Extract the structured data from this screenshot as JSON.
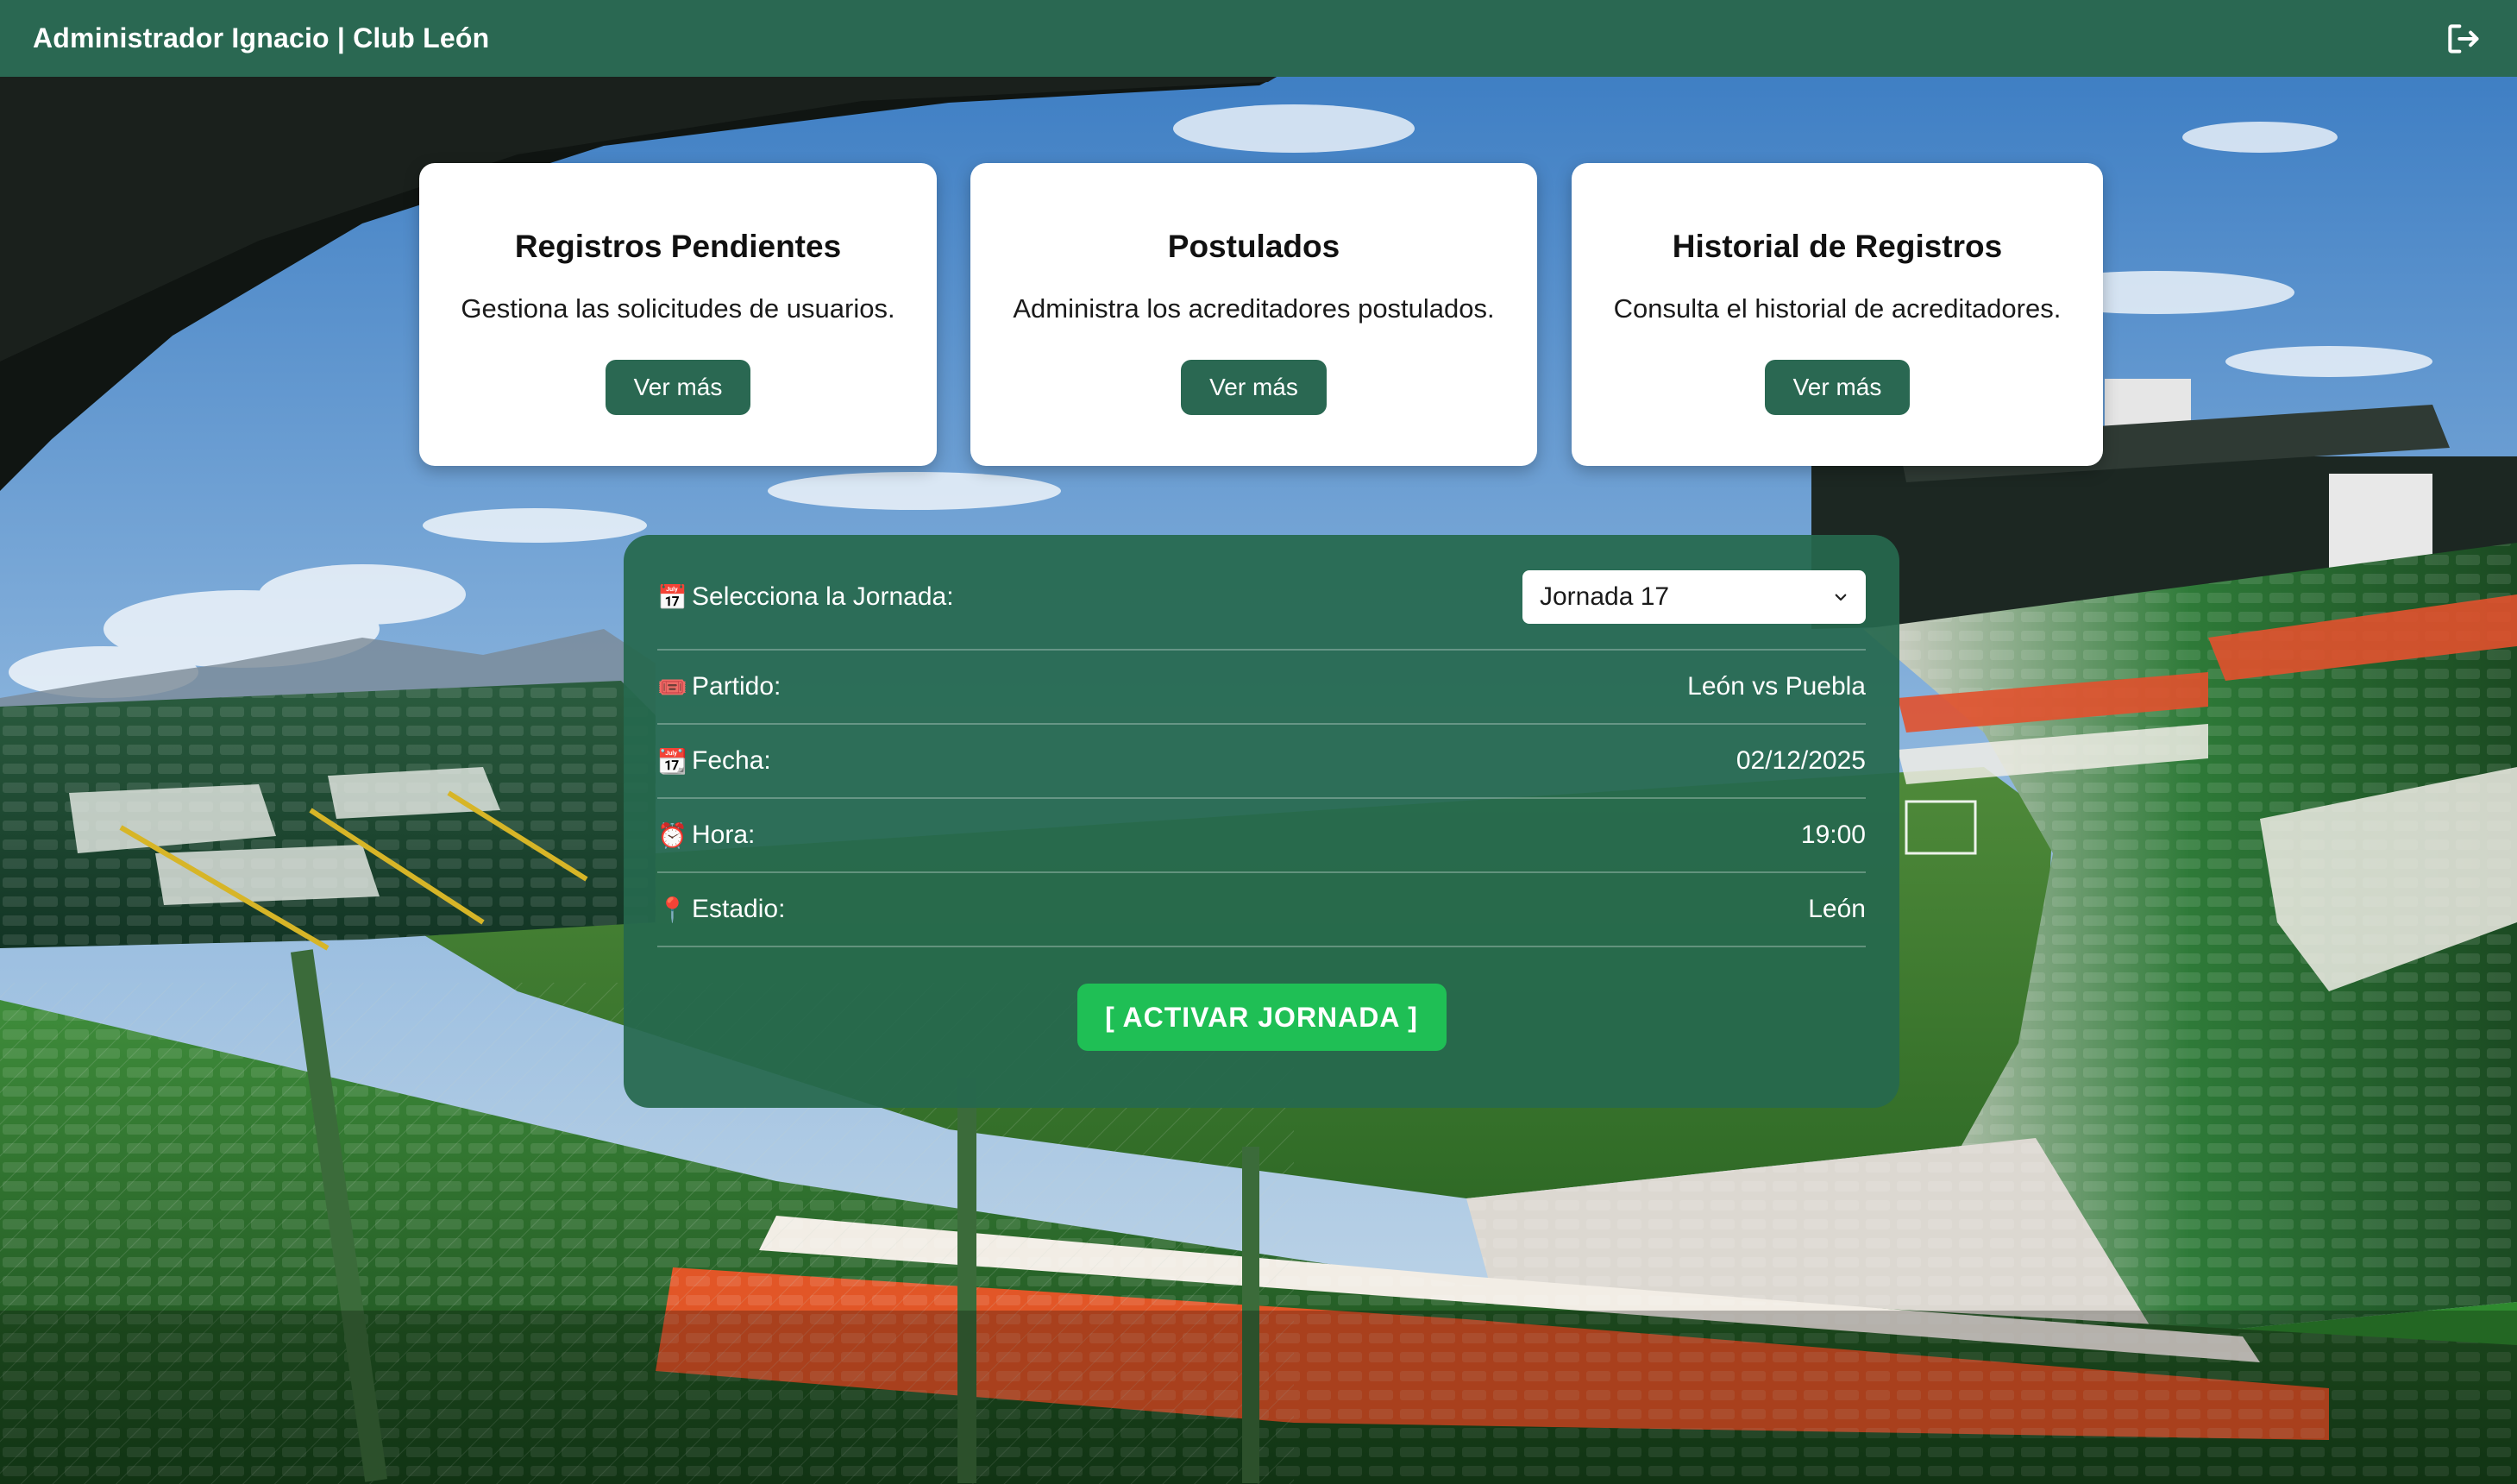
{
  "header": {
    "title": "Administrador Ignacio | Club León",
    "logout_icon": "logout-icon"
  },
  "cards": [
    {
      "title": "Registros Pendientes",
      "description": "Gestiona las solicitudes de usuarios.",
      "button": "Ver más"
    },
    {
      "title": "Postulados",
      "description": "Administra los acreditadores postulados.",
      "button": "Ver más"
    },
    {
      "title": "Historial de Registros",
      "description": "Consulta el historial de acreditadores.",
      "button": "Ver más"
    }
  ],
  "jornada": {
    "select_label": "Selecciona la Jornada:",
    "select_icon": "📅",
    "selected": "Jornada 17",
    "rows": [
      {
        "icon": "🎟️",
        "label": "Partido:",
        "value": "León vs Puebla"
      },
      {
        "icon": "📆",
        "label": "Fecha:",
        "value": "02/12/2025"
      },
      {
        "icon": "⏰",
        "label": "Hora:",
        "value": "19:00"
      },
      {
        "icon": "📍",
        "label": "Estadio:",
        "value": "León"
      }
    ],
    "activate_button": "[ ACTIVAR JORNADA ]"
  },
  "colors": {
    "header": "#2a6852",
    "panel": "#26684e",
    "button": "#2a6852",
    "activate": "#1fbf55"
  }
}
